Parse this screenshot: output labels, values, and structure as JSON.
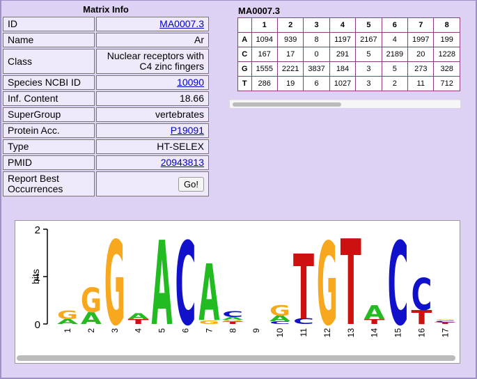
{
  "matrix_info": {
    "title": "Matrix Info",
    "rows": [
      {
        "label": "ID",
        "value": "MA0007.3",
        "link": true
      },
      {
        "label": "Name",
        "value": "Ar",
        "link": false
      },
      {
        "label": "Class",
        "value": "Nuclear receptors with C4 zinc fingers",
        "link": false
      },
      {
        "label": "Species NCBI ID",
        "value": "10090",
        "link": true
      },
      {
        "label": "Inf. Content",
        "value": "18.66",
        "link": false
      },
      {
        "label": "SuperGroup",
        "value": "vertebrates",
        "link": false
      },
      {
        "label": "Protein Acc.",
        "value": "P19091",
        "link": true
      },
      {
        "label": "Type",
        "value": "HT-SELEX",
        "link": false
      },
      {
        "label": "PMID",
        "value": "20943813",
        "link": true
      }
    ],
    "report_label": "Report Best Occurrences",
    "go_button": "Go!"
  },
  "pfm": {
    "title": "MA0007.3",
    "columns": [
      "1",
      "2",
      "3",
      "4",
      "5",
      "6",
      "7",
      "8"
    ],
    "rows": [
      {
        "base": "A",
        "values": [
          "1094",
          "939",
          "8",
          "1197",
          "2167",
          "4",
          "1997",
          "199"
        ]
      },
      {
        "base": "C",
        "values": [
          "167",
          "17",
          "0",
          "291",
          "5",
          "2189",
          "20",
          "1228"
        ]
      },
      {
        "base": "G",
        "values": [
          "1555",
          "2221",
          "3837",
          "184",
          "3",
          "5",
          "273",
          "328"
        ]
      },
      {
        "base": "T",
        "values": [
          "286",
          "19",
          "6",
          "1027",
          "3",
          "2",
          "11",
          "712"
        ]
      }
    ]
  },
  "logo": {
    "ylabel": "bits",
    "yticks": [
      "0",
      "1",
      "2"
    ],
    "positions": [
      "1",
      "2",
      "3",
      "4",
      "5",
      "6",
      "7",
      "8",
      "9",
      "10",
      "11",
      "12",
      "13",
      "14",
      "15",
      "16",
      "17"
    ],
    "colors": {
      "A": "#22bb22",
      "C": "#1111cc",
      "G": "#f7a81e",
      "T": "#cc1111"
    },
    "stacks": [
      [
        [
          "A",
          0.1
        ],
        [
          "G",
          0.18
        ]
      ],
      [
        [
          "A",
          0.25
        ],
        [
          "G",
          0.52
        ]
      ],
      [
        [
          "G",
          1.78
        ]
      ],
      [
        [
          "T",
          0.1
        ],
        [
          "A",
          0.12
        ]
      ],
      [
        [
          "A",
          1.78
        ]
      ],
      [
        [
          "C",
          1.76
        ]
      ],
      [
        [
          "G",
          0.08
        ],
        [
          "A",
          1.2
        ]
      ],
      [
        [
          "T",
          0.05
        ],
        [
          "G",
          0.04
        ],
        [
          "A",
          0.06
        ],
        [
          "C",
          0.12
        ]
      ],
      [],
      [
        [
          "C",
          0.06
        ],
        [
          "A",
          0.12
        ],
        [
          "G",
          0.22
        ]
      ],
      [
        [
          "C",
          0.12
        ],
        [
          "T",
          1.37
        ]
      ],
      [
        [
          "G",
          1.75
        ]
      ],
      [
        [
          "T",
          1.81
        ]
      ],
      [
        [
          "T",
          0.1
        ],
        [
          "A",
          0.3
        ]
      ],
      [
        [
          "C",
          1.76
        ]
      ],
      [
        [
          "T",
          0.3
        ],
        [
          "C",
          0.67
        ]
      ],
      [
        [
          "T",
          0.04
        ],
        [
          "C",
          0.03
        ],
        [
          "G",
          0.02
        ]
      ]
    ]
  }
}
